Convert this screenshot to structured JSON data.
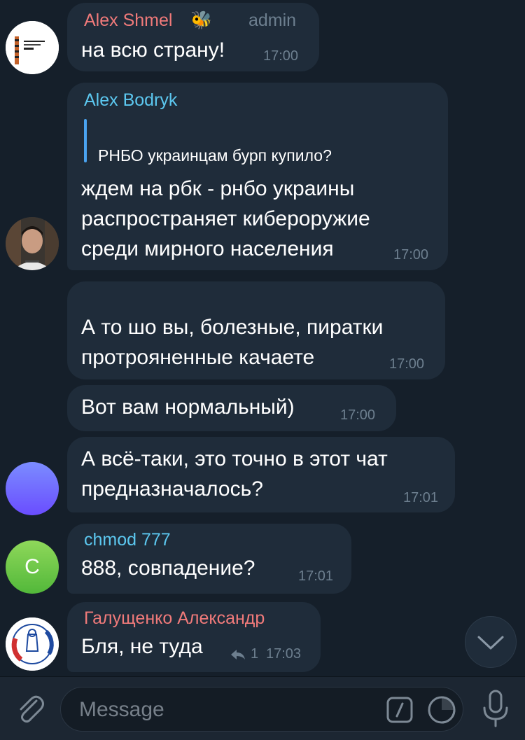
{
  "colors": {
    "background": "#151f2a",
    "bubble": "#1f2c3a",
    "accent": "#4aa3f0",
    "meta": "#6d7f8f",
    "name_shmel": "#f07a7a",
    "name_bodryk": "#5cc8f0",
    "name_chmod": "#5cc8f0",
    "name_galushchenko": "#f07a7a"
  },
  "messages": [
    {
      "sender": "Alex Shmel",
      "sender_emoji": "🐝",
      "role": "admin",
      "text": "на всю страну!",
      "time": "17:00"
    },
    {
      "sender": "Alex Bodryk",
      "reply_text": "РНБО украинцам бурп купило?",
      "lines": [
        "ждем на рбк - рнбо украины",
        "распространяет кибероружие",
        "среди мирного населения"
      ],
      "time": "17:00"
    },
    {
      "lines": [
        "А то шо вы, болезные, пиратки",
        "протрояненные качаете"
      ],
      "time": "17:00"
    },
    {
      "text": "Вот вам нормальный)",
      "time": "17:00"
    },
    {
      "lines": [
        "А всё-таки, это точно в этот чат",
        "предназначалось?"
      ],
      "time": "17:01"
    },
    {
      "sender": "chmod 777",
      "avatar_letter": "C",
      "text": "888, совпадение?",
      "time": "17:01"
    },
    {
      "sender": "Галущенко Александр",
      "text": "Бля, не туда",
      "reply_count": "1",
      "time": "17:03"
    }
  ],
  "input": {
    "placeholder": "Message"
  },
  "icons": {
    "attach": "paperclip-icon",
    "commands": "slash-command-icon",
    "sticker": "sticker-icon",
    "mic": "microphone-icon",
    "scroll": "chevron-down-icon",
    "reply": "reply-arrow-icon"
  }
}
